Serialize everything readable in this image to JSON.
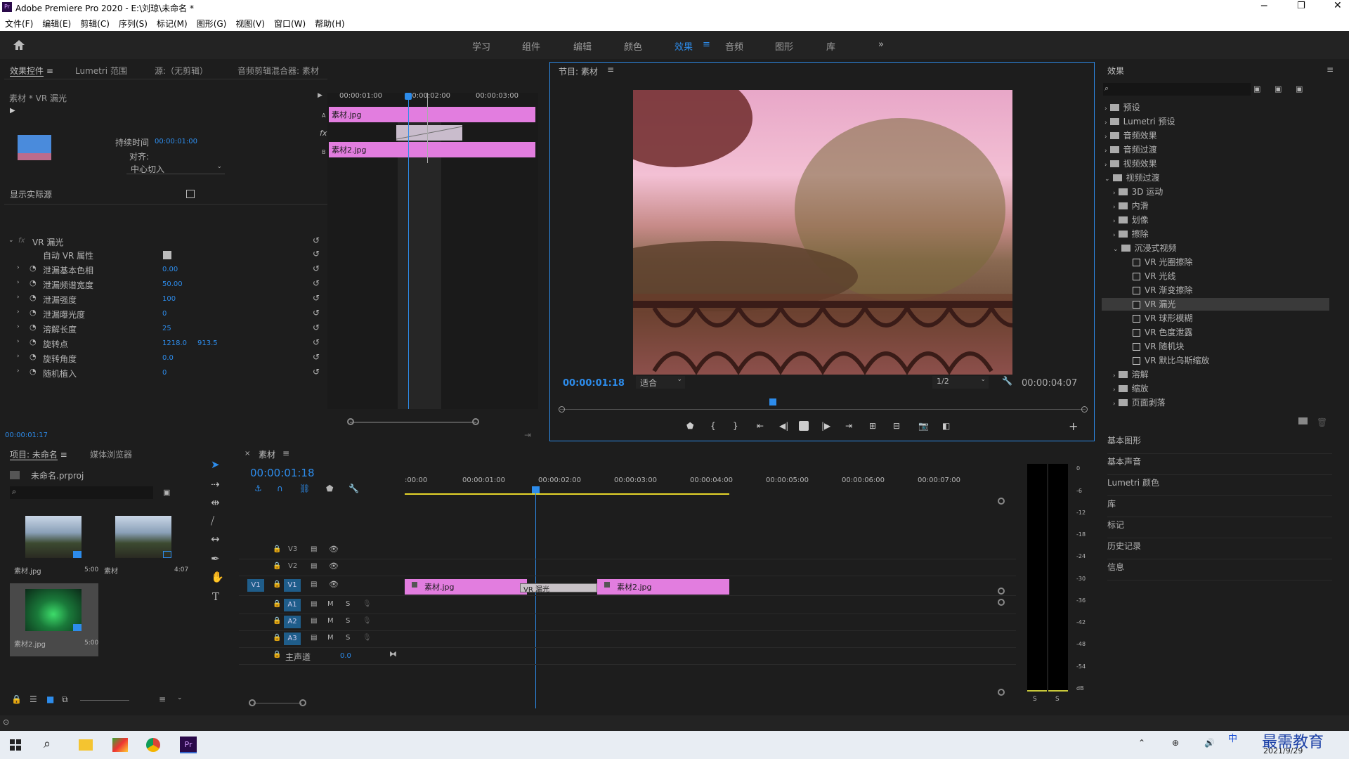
{
  "app": {
    "title": "Adobe Premiere Pro 2020 - E:\\刘琼\\未命名 *",
    "icon": "Pr"
  },
  "menu": [
    "文件(F)",
    "编辑(E)",
    "剪辑(C)",
    "序列(S)",
    "标记(M)",
    "图形(G)",
    "视图(V)",
    "窗口(W)",
    "帮助(H)"
  ],
  "workspaces": [
    "学习",
    "组件",
    "编辑",
    "颜色",
    "效果",
    "音频",
    "图形",
    "库"
  ],
  "active_workspace": "效果",
  "effect_controls": {
    "tabs": [
      "效果控件",
      "Lumetri 范围",
      "源:（无剪辑）",
      "音频剪辑混合器: 素材"
    ],
    "clip_label": "素材 * VR 漏光",
    "duration_label": "持续时间",
    "duration_value": "00:00:01:00",
    "align_label": "对齐:",
    "align_value": "中心切入",
    "show_source": "显示实际源",
    "mini_times": [
      "00:00:01:00",
      "00:00:02:00",
      "00:00:03:00"
    ],
    "clip_a": "素材.jpg",
    "clip_b": "素材2.jpg",
    "effect_name": "VR 漏光",
    "params": [
      {
        "label": "自动 VR 属性",
        "value": ""
      },
      {
        "label": "泄漏基本色相",
        "value": "0.00"
      },
      {
        "label": "泄漏频谱宽度",
        "value": "50.00"
      },
      {
        "label": "泄漏强度",
        "value": "100"
      },
      {
        "label": "泄漏曝光度",
        "value": "0"
      },
      {
        "label": "溶解长度",
        "value": "25"
      },
      {
        "label": "旋转点",
        "value": "1218.0",
        "value2": "913.5"
      },
      {
        "label": "旋转角度",
        "value": "0.0"
      },
      {
        "label": "随机植入",
        "value": "0"
      }
    ],
    "time": "00:00:01:17"
  },
  "program": {
    "title": "节目: 素材",
    "timecode": "00:00:01:18",
    "fit": "适合",
    "res": "1/2",
    "duration": "00:00:04:07"
  },
  "effects": {
    "title": "效果",
    "tree": [
      {
        "label": "预设",
        "level": 0,
        "type": "folder"
      },
      {
        "label": "Lumetri 预设",
        "level": 0,
        "type": "folder"
      },
      {
        "label": "音频效果",
        "level": 0,
        "type": "folder"
      },
      {
        "label": "音频过渡",
        "level": 0,
        "type": "folder"
      },
      {
        "label": "视频效果",
        "level": 0,
        "type": "folder"
      },
      {
        "label": "视频过渡",
        "level": 0,
        "type": "folder",
        "open": true
      },
      {
        "label": "3D 运动",
        "level": 1,
        "type": "folder"
      },
      {
        "label": "内滑",
        "level": 1,
        "type": "folder"
      },
      {
        "label": "划像",
        "level": 1,
        "type": "folder"
      },
      {
        "label": "擦除",
        "level": 1,
        "type": "folder"
      },
      {
        "label": "沉浸式视频",
        "level": 1,
        "type": "folder",
        "open": true
      },
      {
        "label": "VR 光圈擦除",
        "level": 2,
        "type": "fx"
      },
      {
        "label": "VR 光线",
        "level": 2,
        "type": "fx"
      },
      {
        "label": "VR 渐变擦除",
        "level": 2,
        "type": "fx"
      },
      {
        "label": "VR 漏光",
        "level": 2,
        "type": "fx",
        "selected": true
      },
      {
        "label": "VR 球形模糊",
        "level": 2,
        "type": "fx"
      },
      {
        "label": "VR 色度泄露",
        "level": 2,
        "type": "fx"
      },
      {
        "label": "VR 随机块",
        "level": 2,
        "type": "fx"
      },
      {
        "label": "VR 默比乌斯缩放",
        "level": 2,
        "type": "fx"
      },
      {
        "label": "溶解",
        "level": 1,
        "type": "folder"
      },
      {
        "label": "缩放",
        "level": 1,
        "type": "folder"
      },
      {
        "label": "页面剥落",
        "level": 1,
        "type": "folder"
      }
    ],
    "panels": [
      "基本图形",
      "基本声音",
      "Lumetri 颜色",
      "库",
      "标记",
      "历史记录",
      "信息"
    ]
  },
  "project": {
    "tabs": [
      "项目: 未命名",
      "媒体浏览器"
    ],
    "file": "未命名.prproj",
    "items": [
      {
        "name": "素材.jpg",
        "dur": "5:00"
      },
      {
        "name": "素材",
        "dur": "4:07"
      },
      {
        "name": "素材2.jpg",
        "dur": "5:00"
      }
    ]
  },
  "timeline": {
    "tab": "素材",
    "timecode": "00:00:01:18",
    "ruler": [
      ":00:00",
      "00:00:01:00",
      "00:00:02:00",
      "00:00:03:00",
      "00:00:04:00",
      "00:00:05:00",
      "00:00:06:00",
      "00:00:07:00"
    ],
    "video_tracks": [
      "V3",
      "V2",
      "V1"
    ],
    "audio_tracks": [
      "A1",
      "A2",
      "A3"
    ],
    "master": "主声道",
    "master_value": "0.0",
    "clips": [
      "素材.jpg",
      "VR 漏光",
      "素材2.jpg"
    ],
    "src_track": "V1"
  },
  "meter": {
    "scale": [
      "0",
      "-6",
      "-12",
      "-18",
      "-24",
      "-30",
      "-36",
      "-42",
      "-48",
      "-54",
      "dB"
    ],
    "solo": [
      "S",
      "S"
    ]
  },
  "taskbar": {
    "date": "2021/9/29",
    "ime": "中",
    "watermark": "最需教育"
  }
}
